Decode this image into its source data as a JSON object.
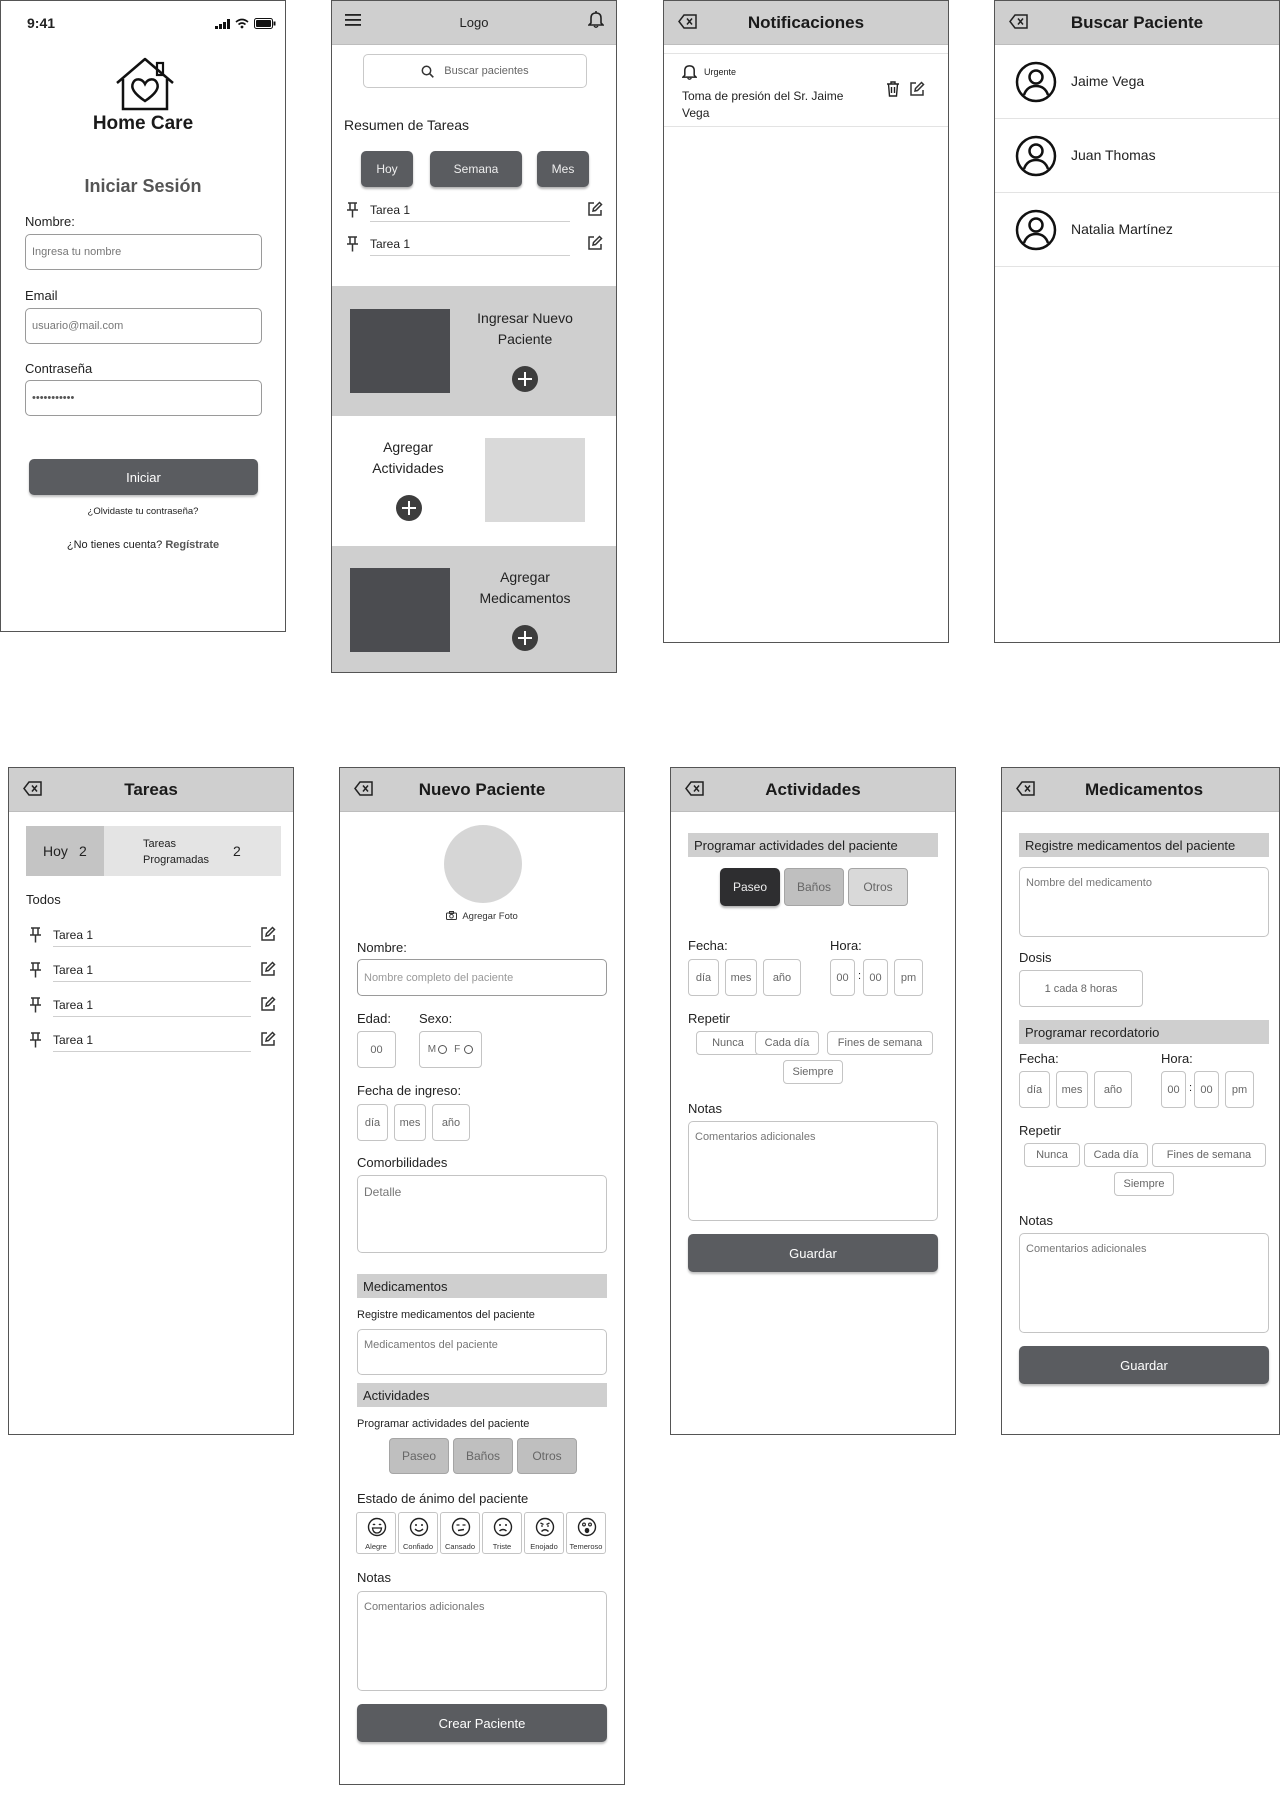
{
  "login": {
    "status_time": "9:41",
    "brand": "Home Care",
    "title": "Iniciar Sesión",
    "name_label": "Nombre:",
    "name_placeholder": "Ingresa tu nombre",
    "email_label": "Email",
    "email_placeholder": "usuario@mail.com",
    "password_label": "Contraseña",
    "password_value": "•••••••••••",
    "submit_label": "Iniciar",
    "forgot_link": "¿Olvidaste tu contraseña?",
    "no_account_text": "¿No tienes cuenta?",
    "register_link": "Regístrate"
  },
  "home": {
    "logo": "Logo",
    "search_placeholder": "Buscar pacientes",
    "summary_title": "Resumen de Tareas",
    "tabs": [
      {
        "label": "Hoy"
      },
      {
        "label": "Semana"
      },
      {
        "label": "Mes"
      }
    ],
    "tasks": [
      {
        "label": "Tarea 1"
      },
      {
        "label": "Tarea 1"
      }
    ],
    "cards": [
      {
        "title": "Ingresar Nuevo Paciente"
      },
      {
        "title": "Agregar Actividades"
      },
      {
        "title": "Agregar Medicamentos"
      }
    ]
  },
  "notifications": {
    "title": "Notificaciones",
    "items": [
      {
        "tag": "Urgente",
        "text": "Toma de presión del Sr. Jaime Vega"
      }
    ]
  },
  "search_patient": {
    "title": "Buscar Paciente",
    "patients": [
      {
        "name": "Jaime Vega"
      },
      {
        "name": "Juan Thomas"
      },
      {
        "name": "Natalia Martínez"
      }
    ]
  },
  "tasks": {
    "title": "Tareas",
    "today_label": "Hoy",
    "today_count": "2",
    "scheduled_label": "Tareas Programadas",
    "scheduled_count": "2",
    "all_label": "Todos",
    "items": [
      {
        "label": "Tarea 1"
      },
      {
        "label": "Tarea 1"
      },
      {
        "label": "Tarea 1"
      },
      {
        "label": "Tarea 1"
      }
    ]
  },
  "new_patient": {
    "title": "Nuevo Paciente",
    "add_photo": "Agregar Foto",
    "name_label": "Nombre:",
    "name_placeholder": "Nombre completo del paciente",
    "age_label": "Edad:",
    "age_value": "00",
    "sex_label": "Sexo:",
    "sex_m": "M",
    "sex_f": "F",
    "admission_label": "Fecha de ingreso:",
    "day": "día",
    "month": "mes",
    "year": "año",
    "comorbidities_label": "Comorbilidades",
    "comorbidities_placeholder": "Detalle",
    "meds_section": "Medicamentos",
    "meds_subtitle": "Registre medicamentos del paciente",
    "meds_placeholder": "Medicamentos del paciente",
    "activities_section": "Actividades",
    "activities_subtitle": "Programar actividades del paciente",
    "activity_options": [
      {
        "label": "Paseo"
      },
      {
        "label": "Baños"
      },
      {
        "label": "Otros"
      }
    ],
    "mood_label": "Estado de ánimo del paciente",
    "moods": [
      {
        "label": "Alegre"
      },
      {
        "label": "Confiado"
      },
      {
        "label": "Cansado"
      },
      {
        "label": "Triste"
      },
      {
        "label": "Enojado"
      },
      {
        "label": "Temeroso"
      }
    ],
    "notes_label": "Notas",
    "notes_placeholder": "Comentarios adicionales",
    "submit_label": "Crear Paciente"
  },
  "activities": {
    "title": "Actividades",
    "section": "Programar actividades del paciente",
    "options": [
      {
        "label": "Paseo"
      },
      {
        "label": "Baños"
      },
      {
        "label": "Otros"
      }
    ],
    "date_label": "Fecha:",
    "time_label": "Hora:",
    "day": "día",
    "month": "mes",
    "year": "año",
    "hour": "00",
    "minute": "00",
    "ampm": "pm",
    "repeat_label": "Repetir",
    "repeat_options": [
      {
        "label": "Nunca"
      },
      {
        "label": "Cada día"
      },
      {
        "label": "Fines de semana"
      },
      {
        "label": "Siempre"
      }
    ],
    "notes_label": "Notas",
    "notes_placeholder": "Comentarios adicionales",
    "save_label": "Guardar"
  },
  "medications": {
    "title": "Medicamentos",
    "section": "Registre medicamentos del paciente",
    "name_placeholder": "Nombre del medicamento",
    "dose_label": "Dosis",
    "dose_value": "1 cada 8 horas",
    "reminder_section": "Programar recordatorio",
    "date_label": "Fecha:",
    "time_label": "Hora:",
    "day": "día",
    "month": "mes",
    "year": "año",
    "hour": "00",
    "minute": "00",
    "ampm": "pm",
    "repeat_label": "Repetir",
    "repeat_options": [
      {
        "label": "Nunca"
      },
      {
        "label": "Cada día"
      },
      {
        "label": "Fines de semana"
      },
      {
        "label": "Siempre"
      }
    ],
    "notes_label": "Notas",
    "notes_placeholder": "Comentarios adicionales",
    "save_label": "Guardar"
  },
  "colors": {
    "header_gray": "#cfcfcf",
    "dark_button": "#5a5c60",
    "card_dark": "#4b4c50",
    "card_light": "#d9d9d9"
  }
}
